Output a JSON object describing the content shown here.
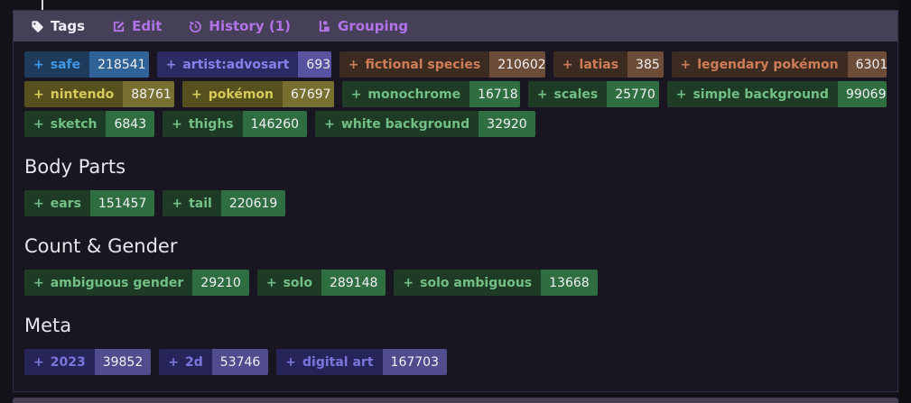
{
  "add_symbol": "+",
  "tabbar": {
    "items": [
      {
        "label": "Tags",
        "icon": "tag-icon",
        "active": true
      },
      {
        "label": "Edit",
        "icon": "edit-icon",
        "active": false
      },
      {
        "label": "History (1)",
        "icon": "history-icon",
        "active": false
      },
      {
        "label": "Grouping",
        "icon": "grouping-icon",
        "active": false
      }
    ]
  },
  "colors": {
    "tabbar_bg": "#463f58",
    "tab_link": "#b273e9",
    "tab_active": "#f2eef7",
    "panel_bg": "#191622",
    "panel_border": "#322e48",
    "heading_text": "#e9e4ec",
    "count_text": "#f2f1f5",
    "categories": {
      "rating": {
        "bg": "#1d3c5c",
        "fg": "#3f97e8",
        "count_bg": "#2f6296"
      },
      "artist": {
        "bg": "#2b2a63",
        "fg": "#8581e9",
        "count_bg": "#5753a0"
      },
      "species": {
        "bg": "#3b2b20",
        "fg": "#cf7d58",
        "count_bg": "#6d4c38"
      },
      "copyright": {
        "bg": "#55501d",
        "fg": "#d6cb5a",
        "count_bg": "#787031"
      },
      "general": {
        "bg": "#1e3b26",
        "fg": "#72c085",
        "count_bg": "#2f6e41"
      },
      "meta": {
        "bg": "#272459",
        "fg": "#7a76dc",
        "count_bg": "#504c8e"
      }
    }
  },
  "sections": [
    {
      "heading": null,
      "rows": [
        [
          {
            "label": "safe",
            "count": "218541",
            "category": "rating"
          },
          {
            "label": "artist:advosart",
            "count": "693",
            "category": "artist"
          },
          {
            "label": "fictional species",
            "count": "210602",
            "category": "species"
          },
          {
            "label": "latias",
            "count": "385",
            "category": "species"
          },
          {
            "label": "legendary pokémon",
            "count": "6301",
            "category": "species"
          }
        ],
        [
          {
            "label": "nintendo",
            "count": "88761",
            "category": "copyright"
          },
          {
            "label": "pokémon",
            "count": "67697",
            "category": "copyright"
          },
          {
            "label": "monochrome",
            "count": "16718",
            "category": "general"
          },
          {
            "label": "scales",
            "count": "25770",
            "category": "general"
          },
          {
            "label": "simple background",
            "count": "99069",
            "category": "general"
          }
        ],
        [
          {
            "label": "sketch",
            "count": "6843",
            "category": "general"
          },
          {
            "label": "thighs",
            "count": "146260",
            "category": "general"
          },
          {
            "label": "white background",
            "count": "32920",
            "category": "general"
          }
        ]
      ]
    },
    {
      "heading": "Body Parts",
      "rows": [
        [
          {
            "label": "ears",
            "count": "151457",
            "category": "general"
          },
          {
            "label": "tail",
            "count": "220619",
            "category": "general"
          }
        ]
      ]
    },
    {
      "heading": "Count & Gender",
      "rows": [
        [
          {
            "label": "ambiguous gender",
            "count": "29210",
            "category": "general"
          },
          {
            "label": "solo",
            "count": "289148",
            "category": "general"
          },
          {
            "label": "solo ambiguous",
            "count": "13668",
            "category": "general"
          }
        ]
      ]
    },
    {
      "heading": "Meta",
      "rows": [
        [
          {
            "label": "2023",
            "count": "39852",
            "category": "meta"
          },
          {
            "label": "2d",
            "count": "53746",
            "category": "meta"
          },
          {
            "label": "digital art",
            "count": "167703",
            "category": "meta"
          }
        ]
      ]
    }
  ]
}
